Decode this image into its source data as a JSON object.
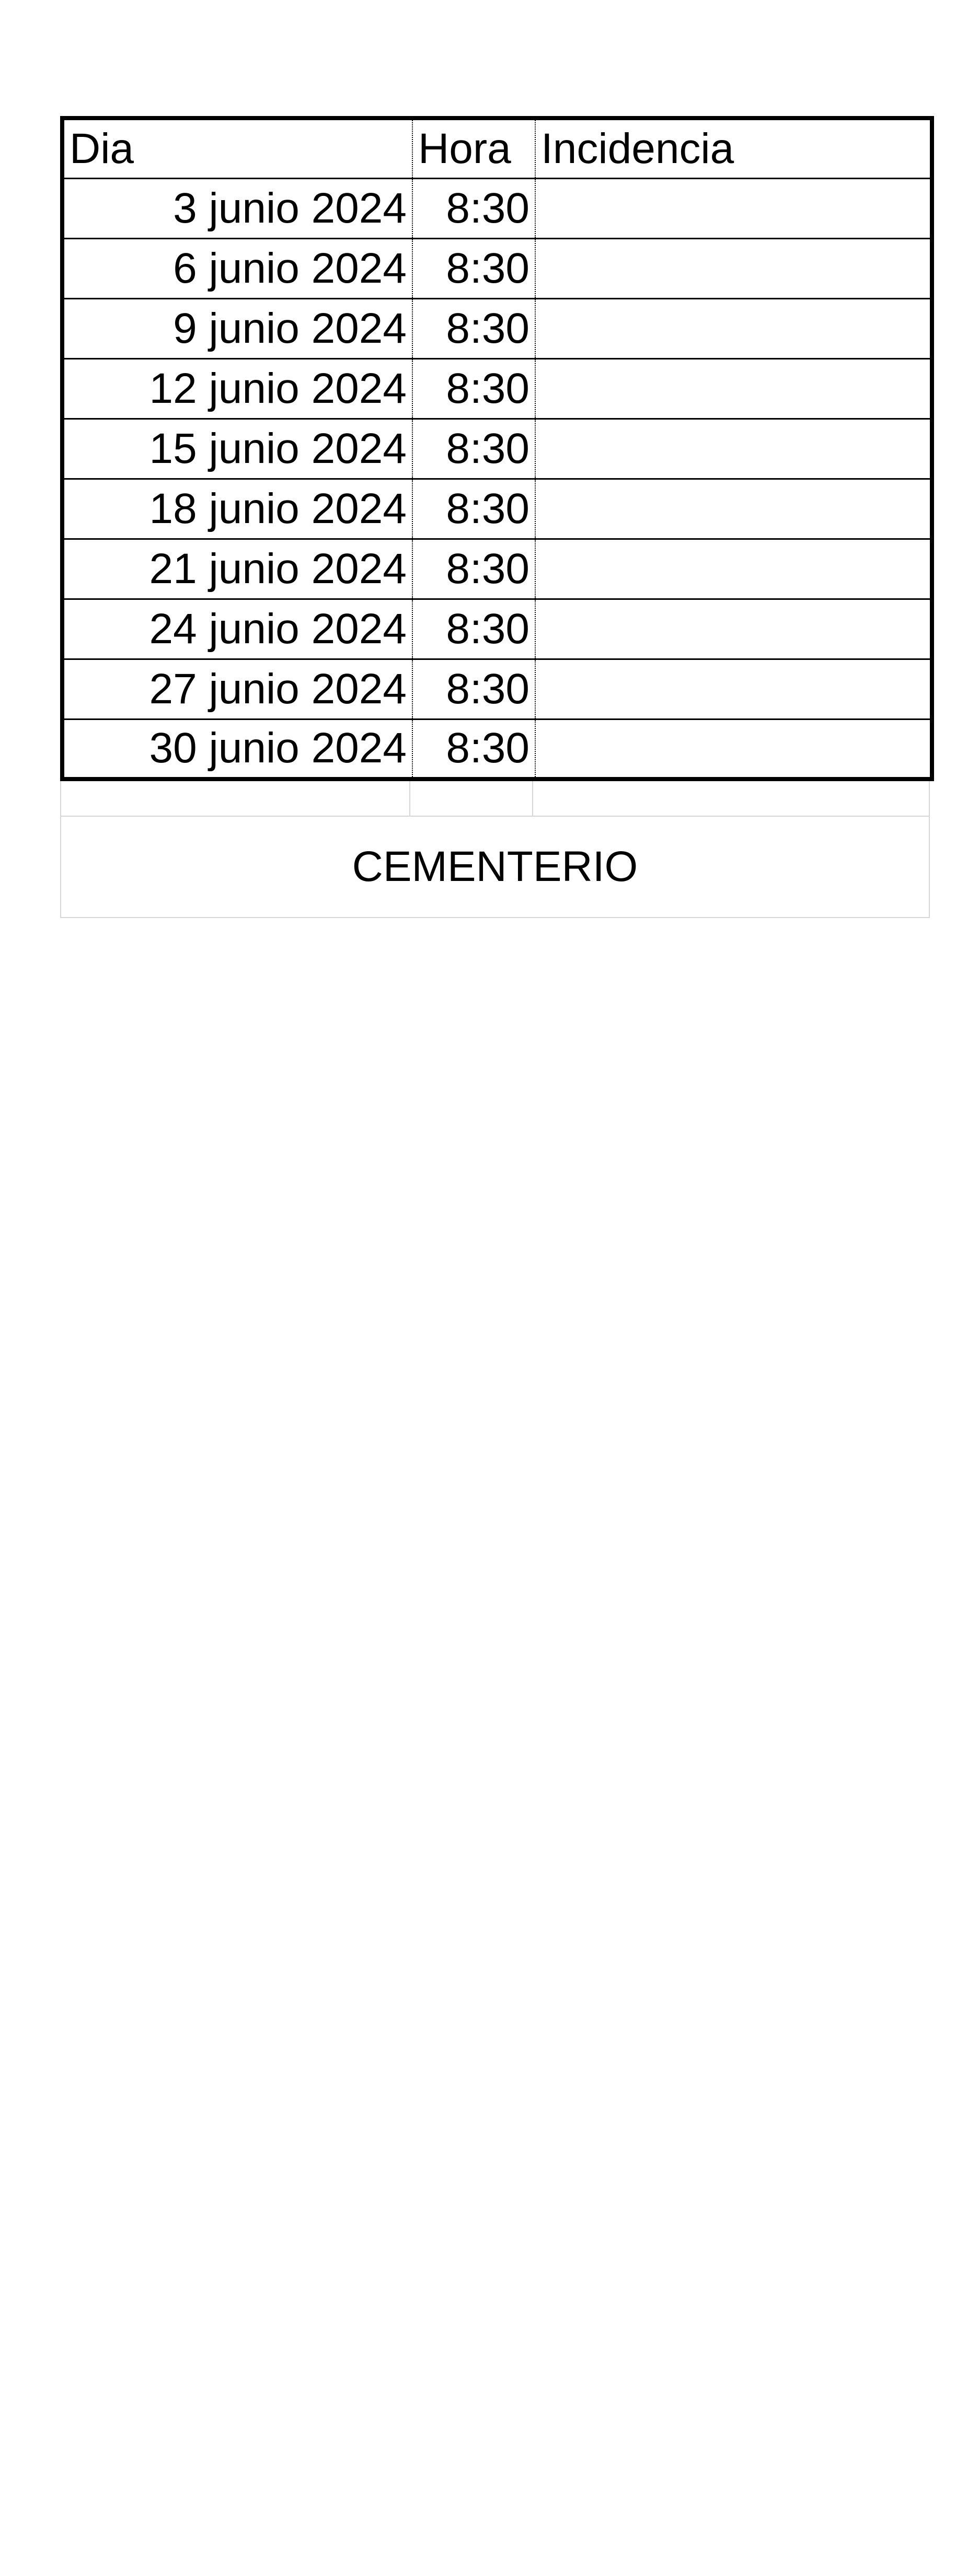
{
  "table": {
    "headers": {
      "dia": "Dia",
      "hora": "Hora",
      "incidencia": "Incidencia"
    },
    "rows": [
      {
        "dia": "3 junio 2024",
        "hora": "8:30",
        "incidencia": ""
      },
      {
        "dia": "6 junio 2024",
        "hora": "8:30",
        "incidencia": ""
      },
      {
        "dia": "9 junio 2024",
        "hora": "8:30",
        "incidencia": ""
      },
      {
        "dia": "12 junio 2024",
        "hora": "8:30",
        "incidencia": ""
      },
      {
        "dia": "15 junio 2024",
        "hora": "8:30",
        "incidencia": ""
      },
      {
        "dia": "18 junio 2024",
        "hora": "8:30",
        "incidencia": ""
      },
      {
        "dia": "21 junio 2024",
        "hora": "8:30",
        "incidencia": ""
      },
      {
        "dia": "24 junio 2024",
        "hora": "8:30",
        "incidencia": ""
      },
      {
        "dia": "27 junio 2024",
        "hora": "8:30",
        "incidencia": ""
      },
      {
        "dia": "30 junio 2024",
        "hora": "8:30",
        "incidencia": ""
      }
    ]
  },
  "footer": {
    "label": "CEMENTERIO"
  }
}
